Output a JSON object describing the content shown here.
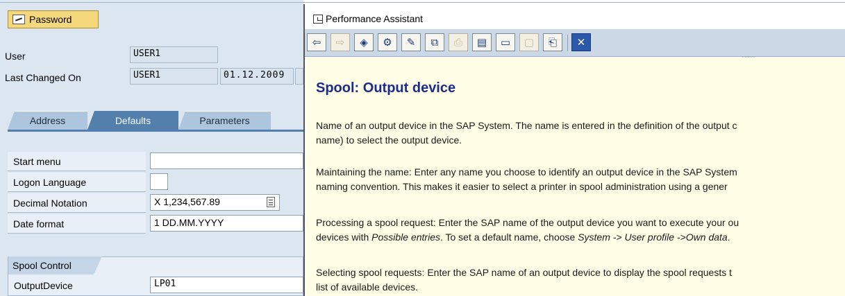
{
  "left_panel": {
    "password_button": "Password",
    "user_label": "User",
    "user_value": "USER1",
    "last_changed_label": "Last Changed On",
    "last_changed_user": "USER1",
    "last_changed_date": "01.12.2009",
    "tabs": [
      {
        "label": "Address"
      },
      {
        "label": "Defaults"
      },
      {
        "label": "Parameters"
      }
    ],
    "defaults": {
      "start_menu_label": "Start menu",
      "start_menu_value": "",
      "logon_language_label": "Logon Language",
      "logon_language_value": "",
      "decimal_notation_label": "Decimal Notation",
      "decimal_notation_value": "X 1,234,567.89",
      "date_format_label": "Date format",
      "date_format_value": "1 DD.MM.YYYY"
    },
    "spool_control": {
      "title": "Spool Control",
      "output_device_label": "OutputDevice",
      "output_device_value": "LP01"
    }
  },
  "performance_assistant": {
    "title": "Performance Assistant",
    "toolbar_icons": [
      "back-arrow-icon",
      "forward-arrow-icon",
      "technical-info-icon",
      "structure-icon",
      "edit-icon",
      "compare-icon",
      "print-preview-icon",
      "glossary-icon",
      "display-icon",
      "save-icon",
      "print-icon",
      "close-icon"
    ],
    "heading": "Spool: Output device",
    "paragraphs": {
      "p1_line1": "Name of an output device in the SAP System. The name is entered in the definition of the output c",
      "p1_line2": "name) to select the output device.",
      "p2_line1": "Maintaining the name: Enter any name you choose to identify an output device in the SAP System",
      "p2_line2": "naming convention. This makes it easier to select a printer in spool administration using a gener",
      "p3_line1": "Processing a spool request: Enter the SAP name of the output device you want to execute your ou",
      "p3_line2a": "devices with ",
      "p3_line2b": "Possible entries",
      "p3_line2c": ". To set a default name, choose ",
      "p3_line2d": "System -> User profile ->Own data",
      "p3_line2e": ".",
      "p4_line1": "Selecting spool requests: Enter the SAP name of an output device to display the spool requests t",
      "p4_line2": "list of available devices."
    }
  }
}
